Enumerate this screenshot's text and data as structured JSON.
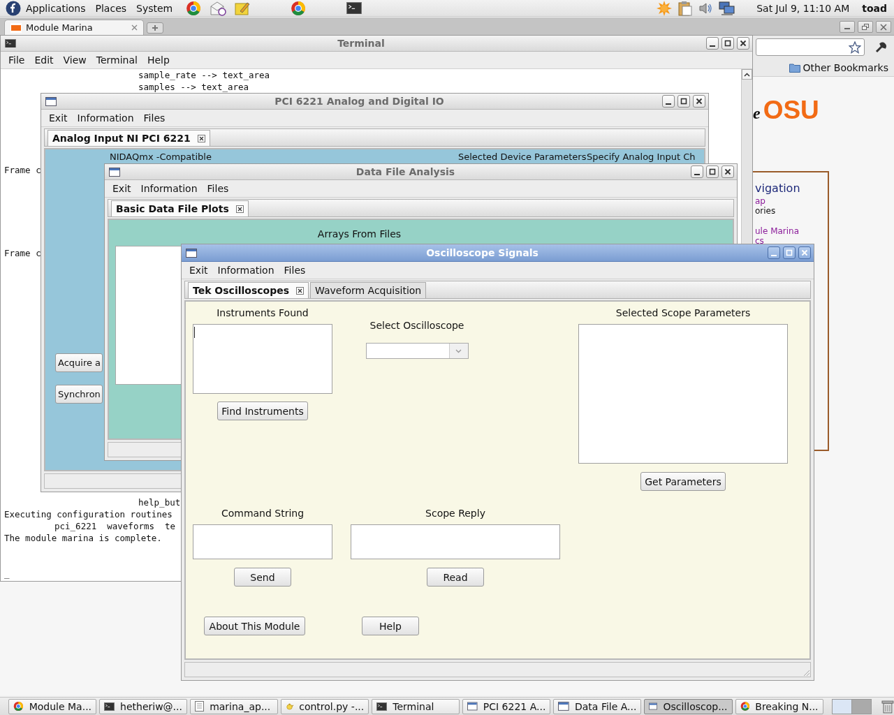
{
  "top_panel": {
    "menus": [
      "Applications",
      "Places",
      "System"
    ],
    "clock": "Sat Jul  9, 11:10 AM",
    "user": "toad"
  },
  "browser": {
    "tab": {
      "label": "Module Marina",
      "selected": true
    },
    "bookmarks": [
      "Other Bookmarks"
    ],
    "page": {
      "logo_fragment": "e",
      "logo": "OSU",
      "nav_heading": "vigation",
      "nav_links": [
        {
          "text": "ap",
          "kind": "link"
        },
        {
          "text": "ories",
          "kind": "plain"
        },
        {
          "text": "ule Marina",
          "kind": "link"
        },
        {
          "text": "cs",
          "kind": "link"
        }
      ]
    }
  },
  "terminal": {
    "title": "Terminal",
    "active": false,
    "menus": [
      "File",
      "Edit",
      "View",
      "Terminal",
      "Help"
    ],
    "lines": [
      {
        "text": "sample_rate --> text_area",
        "kind": "deep"
      },
      {
        "text": "samples --> text_area",
        "kind": "deep"
      },
      {
        "text": "Frame c",
        "kind": "plain"
      },
      {
        "text": "Frame c",
        "kind": "plain"
      },
      {
        "text": "help_but",
        "kind": "deep"
      },
      {
        "text": "Executing configuration routines",
        "kind": "plain"
      },
      {
        "text": "pci_6221  waveforms  te",
        "kind": "mid"
      },
      {
        "text": "The module marina is complete.",
        "kind": "plain"
      },
      {
        "text": "_",
        "kind": "plain"
      }
    ]
  },
  "pci_window": {
    "title": "PCI 6221 Analog and Digital IO",
    "active": false,
    "menus": [
      "Exit",
      "Information",
      "Files"
    ],
    "tabs": [
      {
        "label": "Analog Input NI PCI 6221",
        "selected": true
      }
    ],
    "labels": [
      "NIDAQmx -Compatible",
      "Selected Device Parameters",
      "Specify Analog Input Ch"
    ],
    "buttons": [
      "Acquire a",
      "Synchron"
    ]
  },
  "data_window": {
    "title": "Data File Analysis",
    "active": false,
    "menus": [
      "Exit",
      "Information",
      "Files"
    ],
    "tabs": [
      {
        "label": "Basic Data File Plots",
        "selected": true
      }
    ],
    "heading": "Arrays From Files"
  },
  "scope_window": {
    "title": "Oscilloscope Signals",
    "active": true,
    "menus": [
      "Exit",
      "Information",
      "Files"
    ],
    "tabs": [
      {
        "label": "Tek Oscilloscopes",
        "selected": true
      },
      {
        "label": "Waveform Acquisition",
        "selected": false
      }
    ],
    "instruments": {
      "label": "Instruments Found",
      "button": "Find Instruments"
    },
    "select": {
      "label": "Select Oscilloscope"
    },
    "parameters": {
      "label": "Selected Scope Parameters",
      "button": "Get Parameters"
    },
    "command": {
      "label": "Command String",
      "button": "Send"
    },
    "reply": {
      "label": "Scope Reply",
      "button": "Read"
    },
    "buttons": [
      "About This Module",
      "Help"
    ]
  },
  "taskbar": [
    {
      "label": "Module Ma...",
      "kind": "browser",
      "selected": false
    },
    {
      "label": "hetheriw@...",
      "kind": "terminal",
      "selected": false
    },
    {
      "label": "marina_ap...",
      "kind": "document",
      "selected": false
    },
    {
      "label": "control.py -...",
      "kind": "editor",
      "selected": false
    },
    {
      "label": "Terminal",
      "kind": "terminal",
      "selected": false
    },
    {
      "label": "PCI 6221 A...",
      "kind": "window",
      "selected": false
    },
    {
      "label": "Data File A...",
      "kind": "window",
      "selected": false
    },
    {
      "label": "Oscilloscop...",
      "kind": "window",
      "selected": true
    },
    {
      "label": "Breaking N...",
      "kind": "browser",
      "selected": false
    }
  ]
}
